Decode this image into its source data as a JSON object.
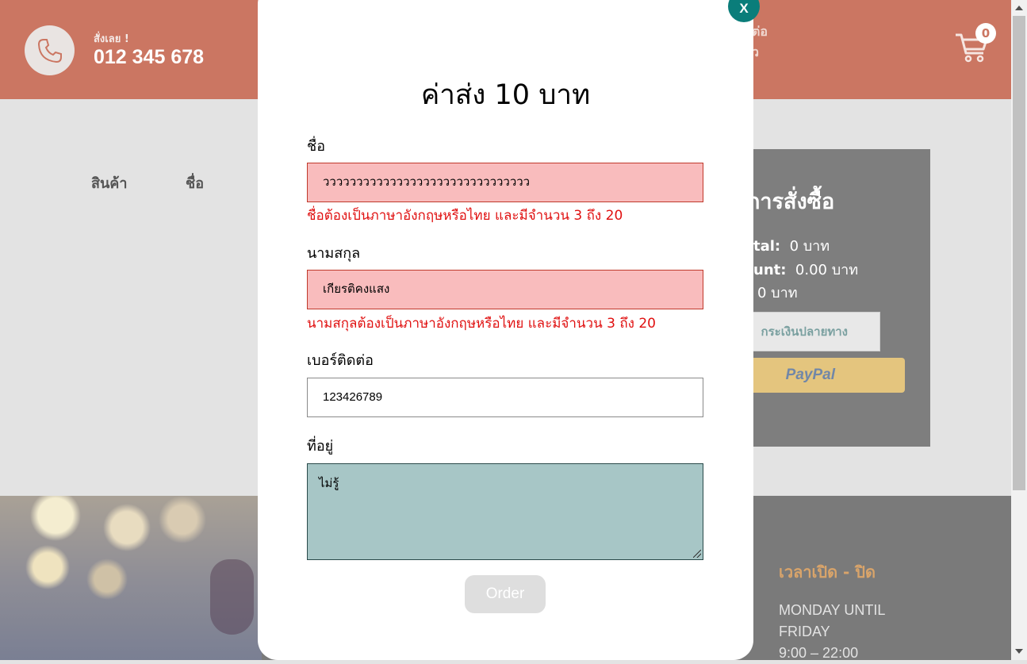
{
  "header": {
    "order_now": "สั่งเลย !",
    "phone": "012 345 678",
    "contact_fragment_line1": "ต่อ",
    "contact_fragment_line2": "ว",
    "cart_count": "0"
  },
  "product_table": {
    "columns": [
      "สินค้า",
      "ชื่อ"
    ]
  },
  "order_summary": {
    "title": "การสั่งซื้อ",
    "subtotal_label": "tal:",
    "subtotal_value": "0 บาท",
    "discount_label": "unt:",
    "discount_value": "0.00 บาท",
    "total_value": "0 บาท",
    "cod_label": "กระเงินปลายทาง",
    "paypal_label": "PayPal"
  },
  "footer": {
    "hours_title": "เวลาเปิด - ปิด",
    "hours_line1": "MONDAY UNTIL",
    "hours_line2": "FRIDAY",
    "hours_line3": "9:00 – 22:00"
  },
  "modal": {
    "close_label": "X",
    "title_prefix": "ค่าส่ง",
    "title_amount": "10",
    "title_suffix": "บาท",
    "first_name": {
      "label": "ชื่อ",
      "value": "ววววววววววววววววววววววววววววววว",
      "error": "ชื่อต้องเป็นภาษาอังกฤษหรือไทย และมีจำนวน 3 ถึง 20"
    },
    "last_name": {
      "label": "นามสกุล",
      "value": "เกียรติคงแสง",
      "error": "นามสกุลต้องเป็นภาษาอังกฤษหรือไทย และมีจำนวน 3 ถึง 20"
    },
    "phone": {
      "label": "เบอร์ติดต่อ",
      "value": "123426789"
    },
    "address": {
      "label": "ที่อยู่",
      "value": "ไม่รู้"
    },
    "order_button": "Order"
  },
  "colors": {
    "header_bg": "#cb7662",
    "close_button": "#0a7d7a",
    "error_text": "#e01010",
    "invalid_field_bg": "#f9bcbd",
    "address_bg": "#a7c6c6"
  }
}
